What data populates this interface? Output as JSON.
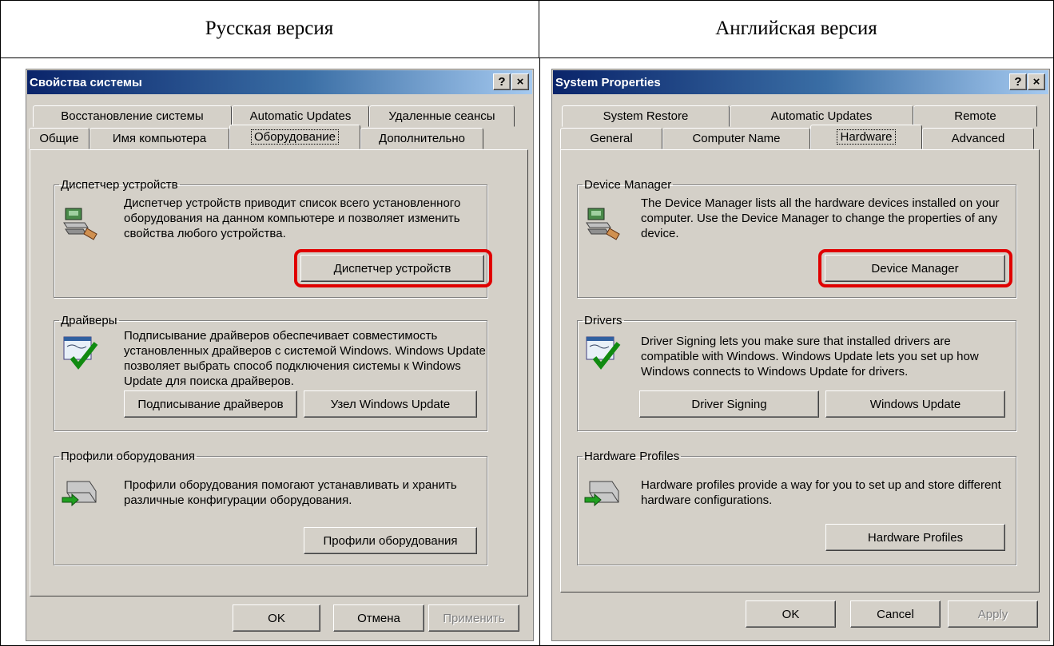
{
  "header": {
    "left_title": "Русская версия",
    "right_title": "Английская версия"
  },
  "dialogs": {
    "ru": {
      "title": "Свойства системы",
      "help_btn": "?",
      "close_btn": "×",
      "tabs_top": [
        "Восстановление системы",
        "Automatic Updates",
        "Удаленные сеансы"
      ],
      "tabs_bottom": [
        "Общие",
        "Имя компьютера",
        "Оборудование",
        "Дополнительно"
      ],
      "device_manager": {
        "legend": "Диспетчер устройств",
        "text": "Диспетчер устройств приводит список всего установленного оборудования на данном компьютере и позволяет изменить свойства любого устройства.",
        "button": "Диспетчер устройств"
      },
      "drivers": {
        "legend": "Драйверы",
        "text": "Подписывание драйверов обеспечивает совместимость установленных драйверов с системой Windows.  Windows Update позволяет выбрать способ подключения системы к Windows Update для поиска драйверов.",
        "button_signing": "Подписывание драйверов",
        "button_update": "Узел Windows Update"
      },
      "profiles": {
        "legend": "Профили оборудования",
        "text": "Профили оборудования помогают устанавливать и хранить различные конфигурации оборудования.",
        "button": "Профили оборудования"
      },
      "ok": "OK",
      "cancel": "Отмена",
      "apply": "Применить"
    },
    "en": {
      "title": "System Properties",
      "help_btn": "?",
      "close_btn": "×",
      "tabs_top": [
        "System Restore",
        "Automatic Updates",
        "Remote"
      ],
      "tabs_bottom": [
        "General",
        "Computer Name",
        "Hardware",
        "Advanced"
      ],
      "device_manager": {
        "legend": "Device Manager",
        "text": "The Device Manager lists all the hardware devices installed on your computer. Use the Device Manager to change the properties of any device.",
        "button": "Device Manager"
      },
      "drivers": {
        "legend": "Drivers",
        "text": "Driver Signing lets you make sure that installed drivers are compatible with Windows. Windows Update lets you set up how Windows connects to Windows Update for drivers.",
        "button_signing": "Driver Signing",
        "button_update": "Windows Update"
      },
      "profiles": {
        "legend": "Hardware Profiles",
        "text": "Hardware profiles provide a way for you to set up and store different hardware configurations.",
        "button": "Hardware Profiles"
      },
      "ok": "OK",
      "cancel": "Cancel",
      "apply": "Apply"
    }
  },
  "colors": {
    "highlight": "#e00000",
    "dialog_face": "#d4d0c8",
    "titlebar": "#0a246a"
  },
  "icons": [
    "device-manager-icon",
    "driver-signing-icon",
    "hardware-profiles-icon"
  ]
}
